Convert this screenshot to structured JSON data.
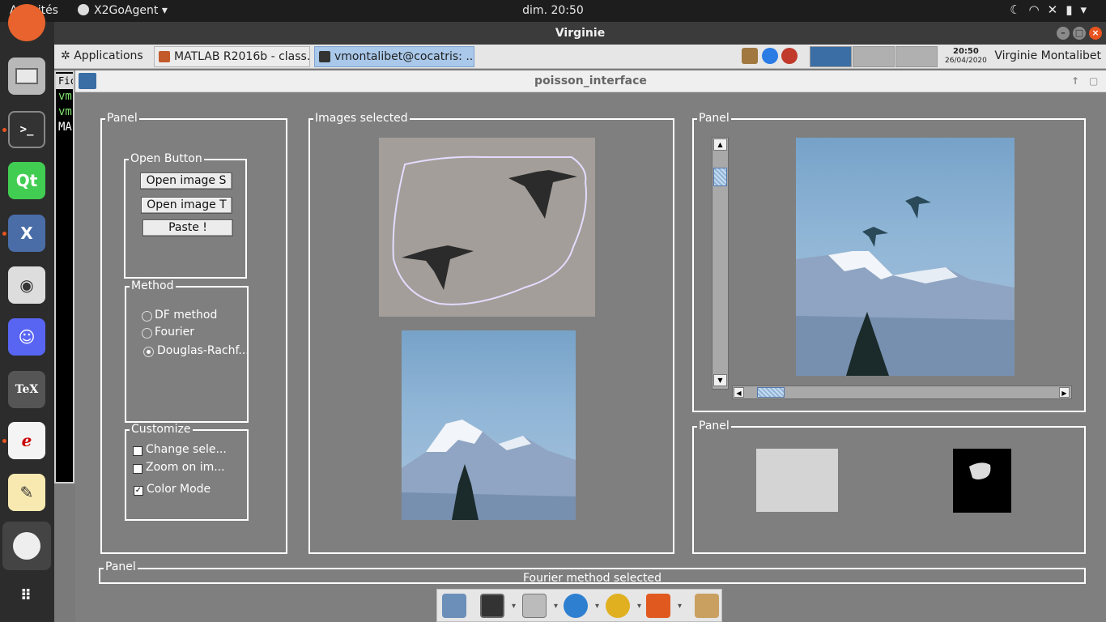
{
  "topbar": {
    "activities": "Activités",
    "app_menu": "X2GoAgent",
    "clock": "dim. 20:50"
  },
  "remote_window": {
    "title": "Virginie"
  },
  "xfce_panel": {
    "applications": "Applications",
    "tasks": [
      {
        "label": "MATLAB R2016b - class..."
      },
      {
        "label": "vmontalibet@cocatris: ..."
      }
    ],
    "clock_time": "20:50",
    "clock_date": "26/04/2020",
    "user": "Virginie Montalibet"
  },
  "terminal": {
    "lines": [
      "vm",
      "vm",
      "MA"
    ],
    "menu_fragment": "Fic"
  },
  "window": {
    "title": "poisson_interface"
  },
  "left_panel": {
    "title": "Panel",
    "open_group": {
      "title": "Open Button",
      "buttons": [
        "Open image S",
        "Open image T",
        "Paste !"
      ]
    },
    "method_group": {
      "title": "Method",
      "options": [
        "DF method",
        "Fourier",
        "Douglas-Rachf..."
      ],
      "selected": "Douglas-Rachf..."
    },
    "customize_group": {
      "title": "Customize",
      "checks": [
        {
          "label": "Change sele...",
          "checked": false
        },
        {
          "label": "Zoom on im...",
          "checked": false
        },
        {
          "label": "Color Mode",
          "checked": true
        }
      ]
    }
  },
  "images_panel": {
    "title": "Images selected"
  },
  "result_panel": {
    "title": "Panel"
  },
  "masks_panel": {
    "title": "Panel"
  },
  "status_panel": {
    "title": "Panel",
    "message": "Fourier method selected"
  },
  "colors": {
    "accent": "#3a6ea5",
    "panel_bg": "#7f7f7f",
    "selection_outline": "#e3dcff"
  }
}
